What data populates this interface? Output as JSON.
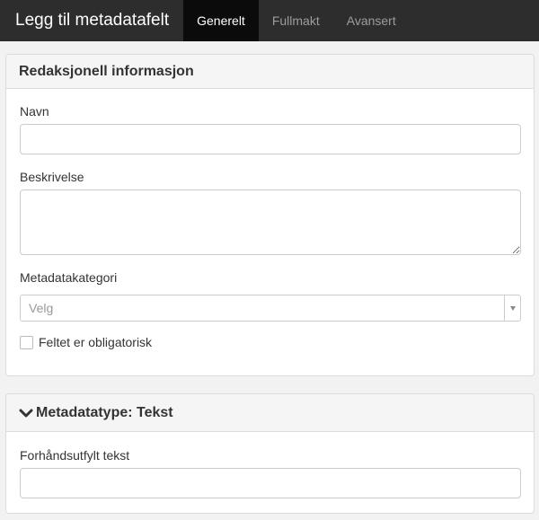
{
  "header": {
    "title": "Legg til metadatafelt",
    "tabs": [
      {
        "label": "Generelt",
        "active": true
      },
      {
        "label": "Fullmakt",
        "active": false
      },
      {
        "label": "Avansert",
        "active": false
      }
    ]
  },
  "editorial": {
    "heading": "Redaksjonell informasjon",
    "name_label": "Navn",
    "name_value": "",
    "description_label": "Beskrivelse",
    "description_value": "",
    "category_label": "Metadatakategori",
    "category_placeholder": "Velg",
    "required_label": "Feltet er obligatorisk",
    "required_checked": false
  },
  "metadatatype": {
    "heading": "Metadatatype: Tekst",
    "prefill_label": "Forhåndsutfylt tekst",
    "prefill_value": ""
  }
}
